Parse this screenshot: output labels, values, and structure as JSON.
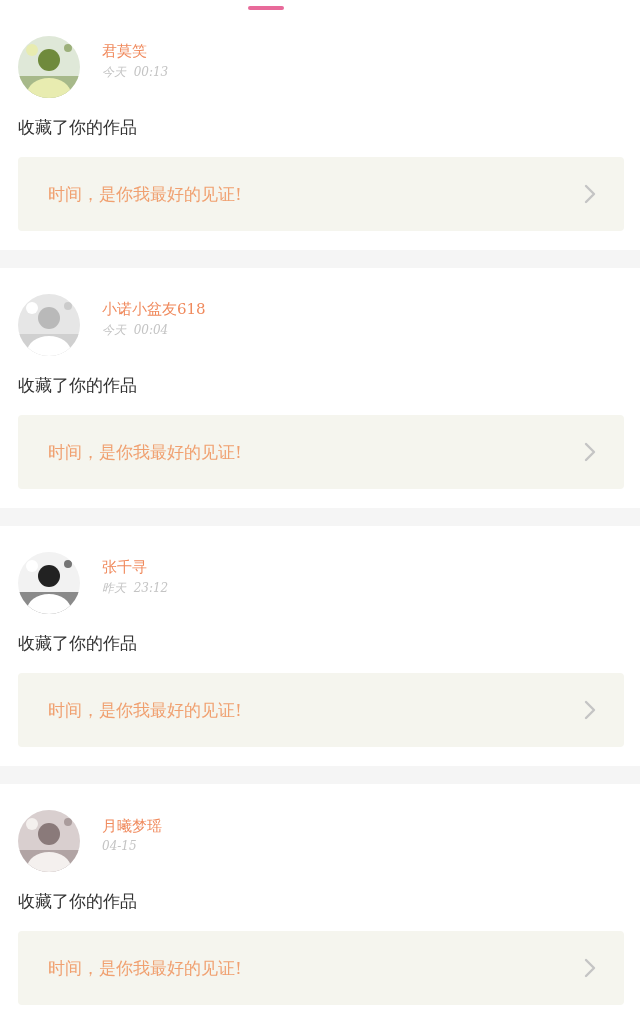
{
  "notifications": [
    {
      "user": "君莫笑",
      "time": "今天  00:13",
      "action": "收藏了你的作品",
      "work_title": "时间，是你我最好的见证!"
    },
    {
      "user": "小诺小盆友618",
      "time": "今天  00:04",
      "action": "收藏了你的作品",
      "work_title": "时间，是你我最好的见证!"
    },
    {
      "user": "张千寻",
      "time": "昨天  23:12",
      "action": "收藏了你的作品",
      "work_title": "时间，是你我最好的见证!"
    },
    {
      "user": "月曦梦瑶",
      "time": "04-15",
      "action": "收藏了你的作品",
      "work_title": "时间，是你我最好的见证!"
    }
  ]
}
